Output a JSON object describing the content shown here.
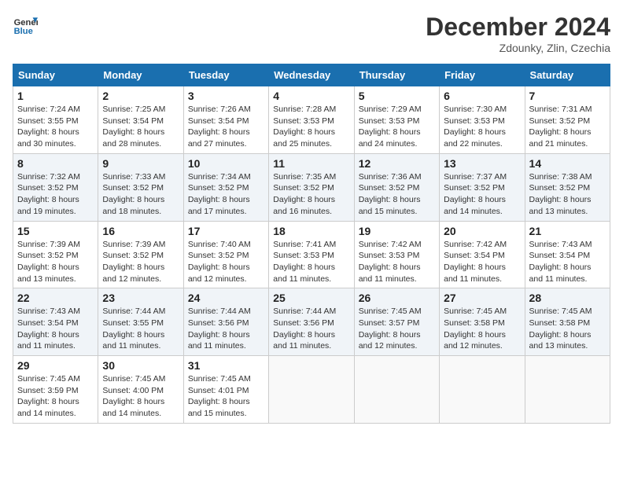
{
  "header": {
    "logo_line1": "General",
    "logo_line2": "Blue",
    "month_title": "December 2024",
    "location": "Zdounky, Zlin, Czechia"
  },
  "days_of_week": [
    "Sunday",
    "Monday",
    "Tuesday",
    "Wednesday",
    "Thursday",
    "Friday",
    "Saturday"
  ],
  "weeks": [
    [
      {
        "day": "1",
        "sunrise": "7:24 AM",
        "sunset": "3:55 PM",
        "daylight": "8 hours and 30 minutes."
      },
      {
        "day": "2",
        "sunrise": "7:25 AM",
        "sunset": "3:54 PM",
        "daylight": "8 hours and 28 minutes."
      },
      {
        "day": "3",
        "sunrise": "7:26 AM",
        "sunset": "3:54 PM",
        "daylight": "8 hours and 27 minutes."
      },
      {
        "day": "4",
        "sunrise": "7:28 AM",
        "sunset": "3:53 PM",
        "daylight": "8 hours and 25 minutes."
      },
      {
        "day": "5",
        "sunrise": "7:29 AM",
        "sunset": "3:53 PM",
        "daylight": "8 hours and 24 minutes."
      },
      {
        "day": "6",
        "sunrise": "7:30 AM",
        "sunset": "3:53 PM",
        "daylight": "8 hours and 22 minutes."
      },
      {
        "day": "7",
        "sunrise": "7:31 AM",
        "sunset": "3:52 PM",
        "daylight": "8 hours and 21 minutes."
      }
    ],
    [
      {
        "day": "8",
        "sunrise": "7:32 AM",
        "sunset": "3:52 PM",
        "daylight": "8 hours and 19 minutes."
      },
      {
        "day": "9",
        "sunrise": "7:33 AM",
        "sunset": "3:52 PM",
        "daylight": "8 hours and 18 minutes."
      },
      {
        "day": "10",
        "sunrise": "7:34 AM",
        "sunset": "3:52 PM",
        "daylight": "8 hours and 17 minutes."
      },
      {
        "day": "11",
        "sunrise": "7:35 AM",
        "sunset": "3:52 PM",
        "daylight": "8 hours and 16 minutes."
      },
      {
        "day": "12",
        "sunrise": "7:36 AM",
        "sunset": "3:52 PM",
        "daylight": "8 hours and 15 minutes."
      },
      {
        "day": "13",
        "sunrise": "7:37 AM",
        "sunset": "3:52 PM",
        "daylight": "8 hours and 14 minutes."
      },
      {
        "day": "14",
        "sunrise": "7:38 AM",
        "sunset": "3:52 PM",
        "daylight": "8 hours and 13 minutes."
      }
    ],
    [
      {
        "day": "15",
        "sunrise": "7:39 AM",
        "sunset": "3:52 PM",
        "daylight": "8 hours and 13 minutes."
      },
      {
        "day": "16",
        "sunrise": "7:39 AM",
        "sunset": "3:52 PM",
        "daylight": "8 hours and 12 minutes."
      },
      {
        "day": "17",
        "sunrise": "7:40 AM",
        "sunset": "3:52 PM",
        "daylight": "8 hours and 12 minutes."
      },
      {
        "day": "18",
        "sunrise": "7:41 AM",
        "sunset": "3:53 PM",
        "daylight": "8 hours and 11 minutes."
      },
      {
        "day": "19",
        "sunrise": "7:42 AM",
        "sunset": "3:53 PM",
        "daylight": "8 hours and 11 minutes."
      },
      {
        "day": "20",
        "sunrise": "7:42 AM",
        "sunset": "3:54 PM",
        "daylight": "8 hours and 11 minutes."
      },
      {
        "day": "21",
        "sunrise": "7:43 AM",
        "sunset": "3:54 PM",
        "daylight": "8 hours and 11 minutes."
      }
    ],
    [
      {
        "day": "22",
        "sunrise": "7:43 AM",
        "sunset": "3:54 PM",
        "daylight": "8 hours and 11 minutes."
      },
      {
        "day": "23",
        "sunrise": "7:44 AM",
        "sunset": "3:55 PM",
        "daylight": "8 hours and 11 minutes."
      },
      {
        "day": "24",
        "sunrise": "7:44 AM",
        "sunset": "3:56 PM",
        "daylight": "8 hours and 11 minutes."
      },
      {
        "day": "25",
        "sunrise": "7:44 AM",
        "sunset": "3:56 PM",
        "daylight": "8 hours and 11 minutes."
      },
      {
        "day": "26",
        "sunrise": "7:45 AM",
        "sunset": "3:57 PM",
        "daylight": "8 hours and 12 minutes."
      },
      {
        "day": "27",
        "sunrise": "7:45 AM",
        "sunset": "3:58 PM",
        "daylight": "8 hours and 12 minutes."
      },
      {
        "day": "28",
        "sunrise": "7:45 AM",
        "sunset": "3:58 PM",
        "daylight": "8 hours and 13 minutes."
      }
    ],
    [
      {
        "day": "29",
        "sunrise": "7:45 AM",
        "sunset": "3:59 PM",
        "daylight": "8 hours and 14 minutes."
      },
      {
        "day": "30",
        "sunrise": "7:45 AM",
        "sunset": "4:00 PM",
        "daylight": "8 hours and 14 minutes."
      },
      {
        "day": "31",
        "sunrise": "7:45 AM",
        "sunset": "4:01 PM",
        "daylight": "8 hours and 15 minutes."
      },
      null,
      null,
      null,
      null
    ]
  ]
}
